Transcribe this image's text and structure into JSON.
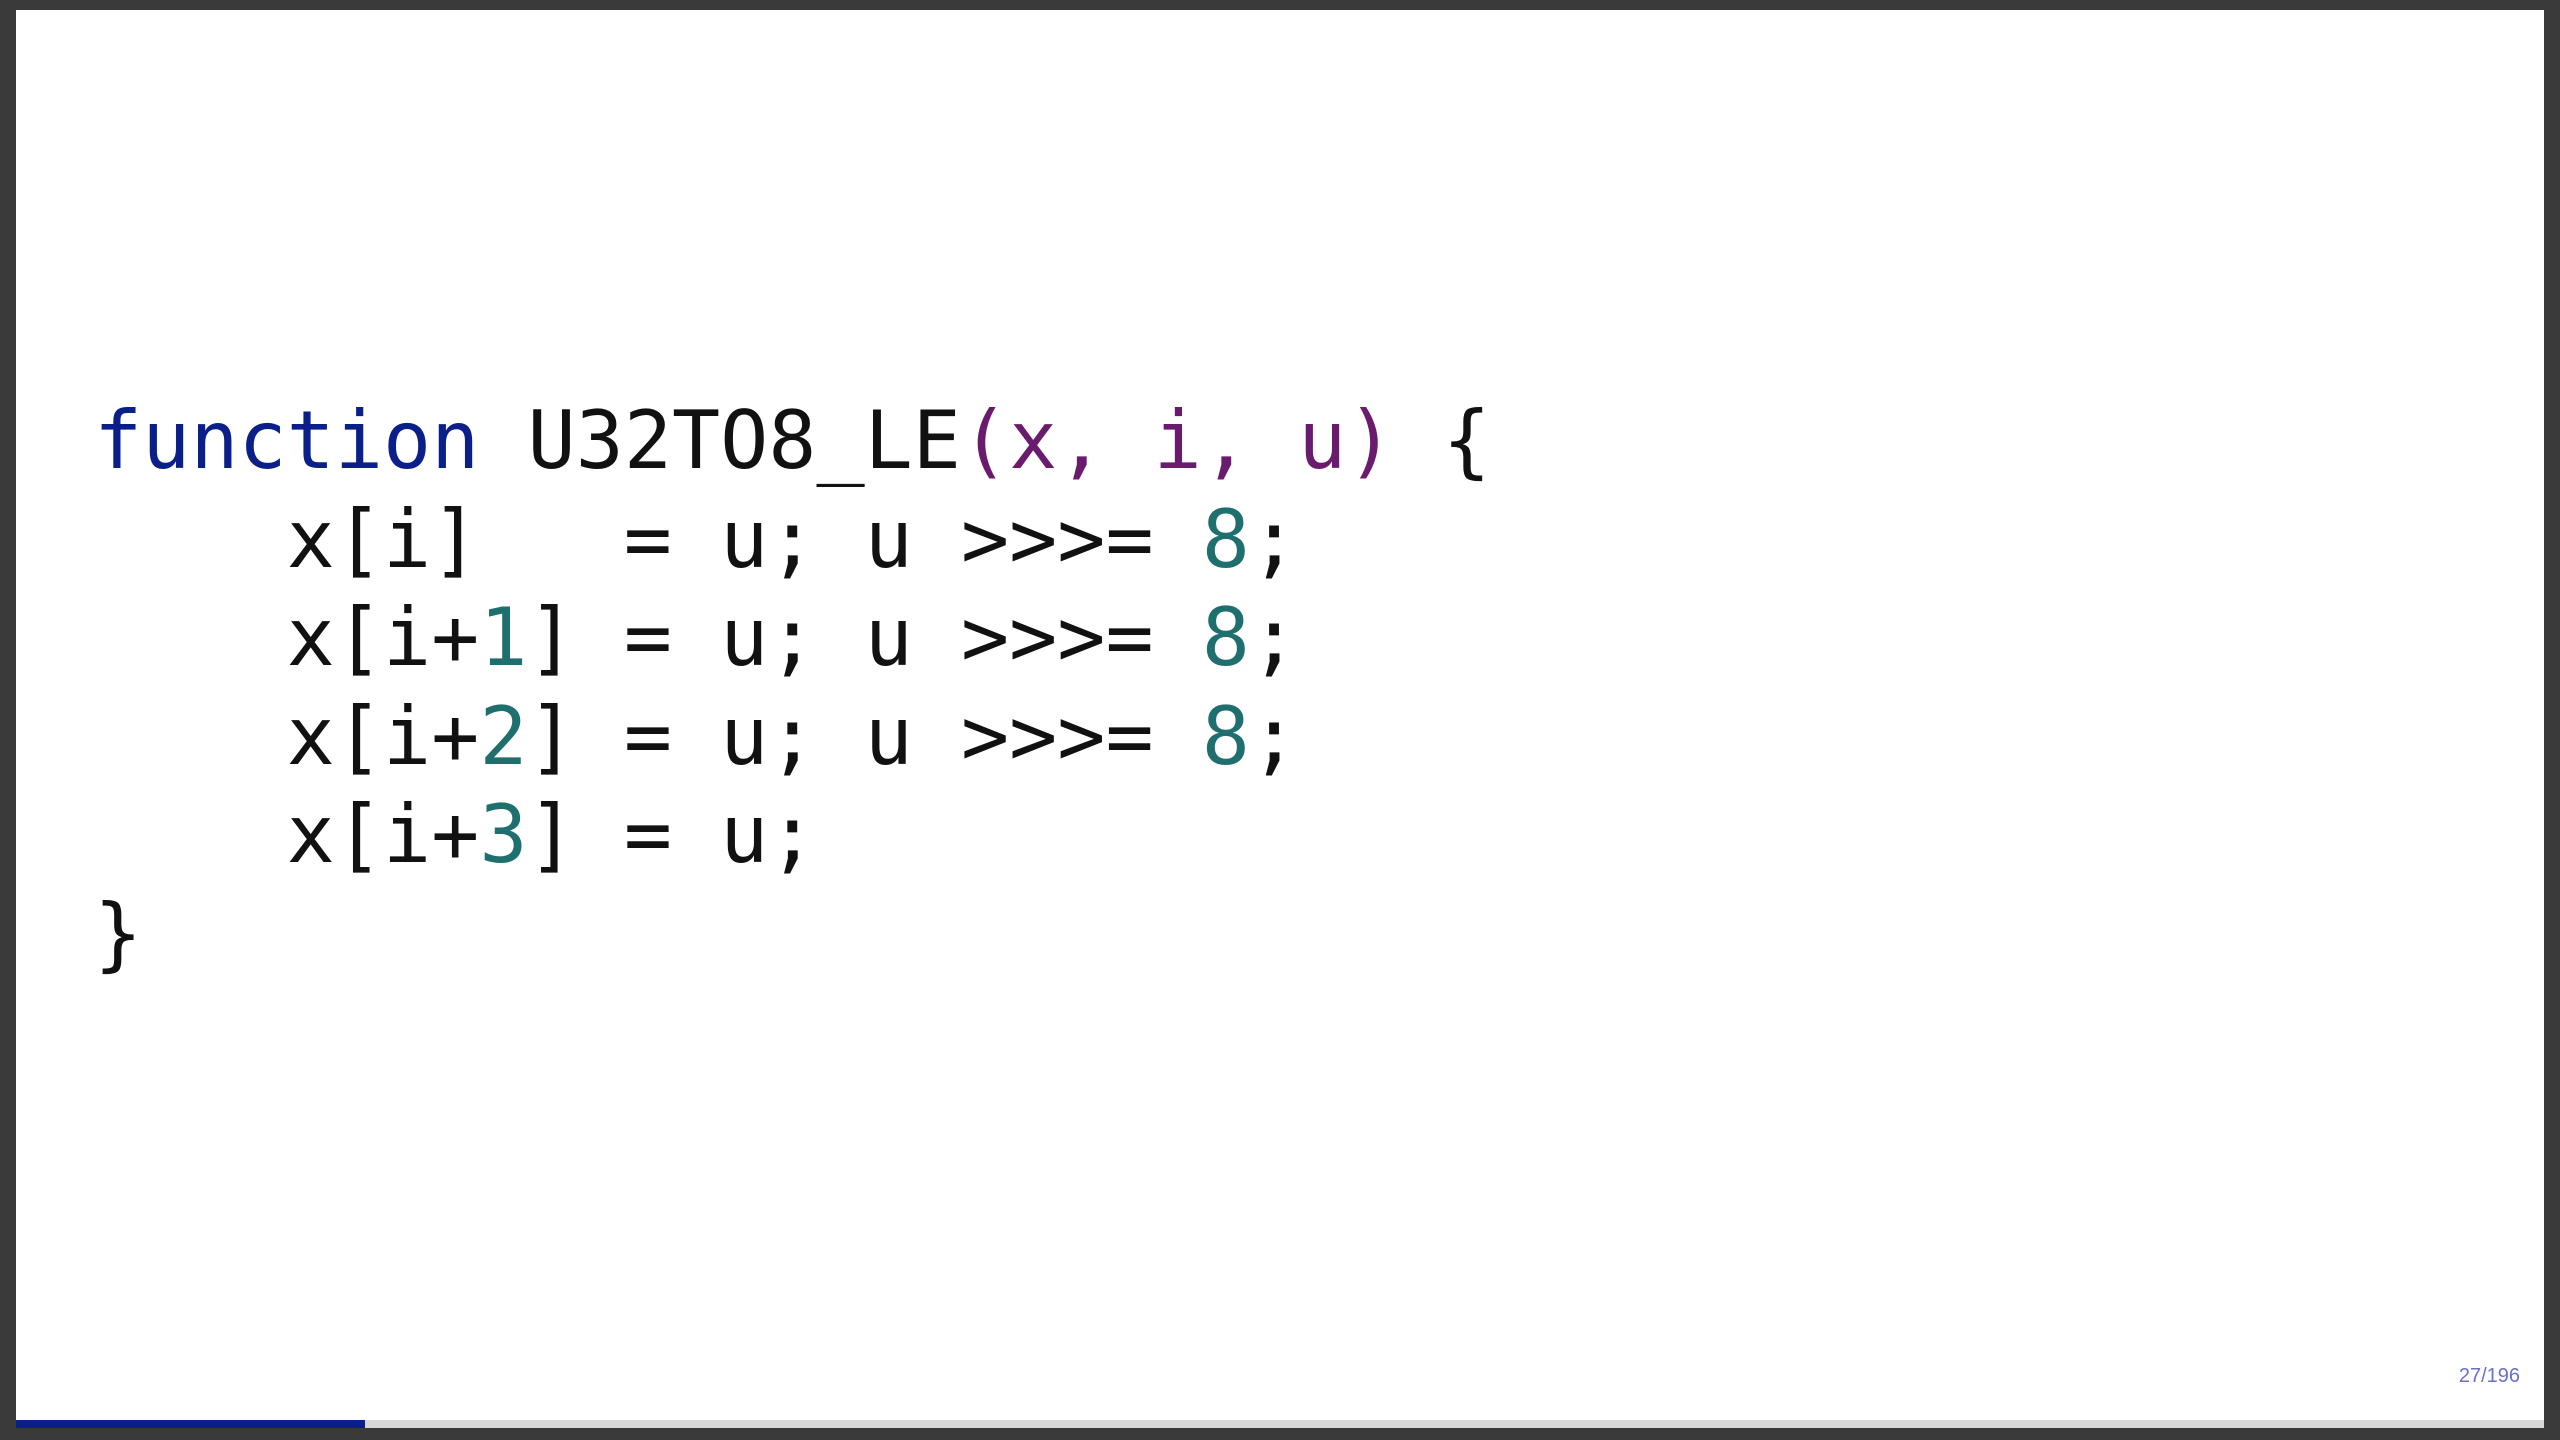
{
  "code": {
    "lines": [
      [
        {
          "t": "function",
          "k": "kw"
        },
        {
          "t": " ",
          "k": "pl"
        },
        {
          "t": "U32TO8_LE",
          "k": "pl"
        },
        {
          "t": "(x, i, u)",
          "k": "prm"
        },
        {
          "t": " {",
          "k": "pl"
        }
      ],
      [
        {
          "t": "    x[i]   = u; u >>>= ",
          "k": "pl"
        },
        {
          "t": "8",
          "k": "num"
        },
        {
          "t": ";",
          "k": "pl"
        }
      ],
      [
        {
          "t": "    x[i+",
          "k": "pl"
        },
        {
          "t": "1",
          "k": "num"
        },
        {
          "t": "] = u; u >>>= ",
          "k": "pl"
        },
        {
          "t": "8",
          "k": "num"
        },
        {
          "t": ";",
          "k": "pl"
        }
      ],
      [
        {
          "t": "    x[i+",
          "k": "pl"
        },
        {
          "t": "2",
          "k": "num"
        },
        {
          "t": "] = u; u >>>= ",
          "k": "pl"
        },
        {
          "t": "8",
          "k": "num"
        },
        {
          "t": ";",
          "k": "pl"
        }
      ],
      [
        {
          "t": "    x[i+",
          "k": "pl"
        },
        {
          "t": "3",
          "k": "num"
        },
        {
          "t": "] = u;",
          "k": "pl"
        }
      ],
      [
        {
          "t": "}",
          "k": "pl"
        }
      ]
    ]
  },
  "footer": {
    "slide_counter": "27/196",
    "progress_fraction": 0.138
  },
  "colors": {
    "keyword": "#0b1f8a",
    "params": "#6a1b6e",
    "number": "#1f6f6f",
    "progress": "#0b1f8a",
    "counter": "#6a6fc8"
  }
}
